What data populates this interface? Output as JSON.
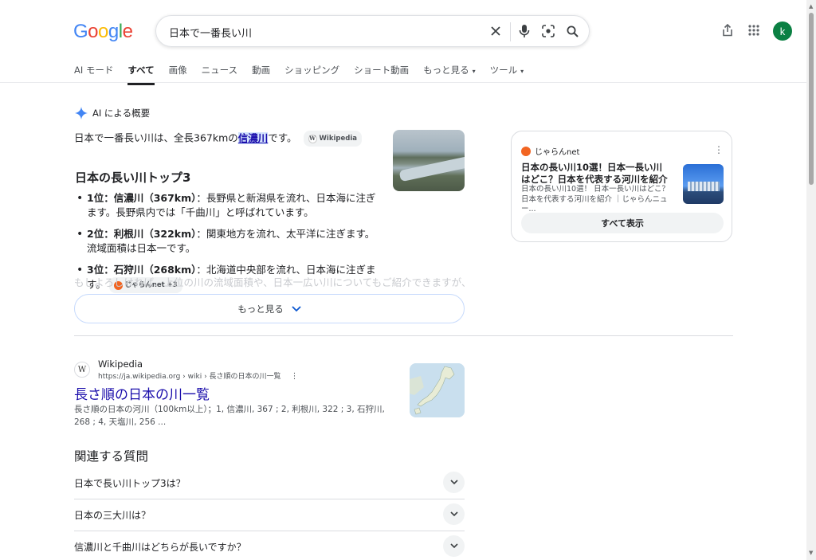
{
  "logo_letters": [
    "G",
    "o",
    "o",
    "g",
    "l",
    "e"
  ],
  "search": {
    "query": "日本で一番長い川"
  },
  "user": {
    "initial": "k"
  },
  "tabs": [
    {
      "label": "AI モード",
      "caret": ""
    },
    {
      "label": "すべて",
      "caret": ""
    },
    {
      "label": "画像",
      "caret": ""
    },
    {
      "label": "ニュース",
      "caret": ""
    },
    {
      "label": "動画",
      "caret": ""
    },
    {
      "label": "ショッピング",
      "caret": ""
    },
    {
      "label": "ショート動画",
      "caret": ""
    },
    {
      "label": "もっと見る",
      "caret": "▾"
    },
    {
      "label": "ツール",
      "caret": "▾"
    }
  ],
  "ai": {
    "heading": "AI による概要",
    "intro_pre": "日本で一番長い川は、全長367kmの",
    "intro_link": "信濃川",
    "intro_post": "です。",
    "intro_chip": "Wikipedia",
    "section_title": "日本の長い川トップ3",
    "items": [
      {
        "bold": "1位：信濃川（367km）",
        "text": "：長野県と新潟県を流れ、日本海に注ぎます。長野県内では「千曲川」と呼ばれています。"
      },
      {
        "bold": "2位：利根川（322km）",
        "text": "：関東地方を流れ、太平洋に注ぎます。流域面積は日本一です。"
      },
      {
        "bold": "3位：石狩川（268km）",
        "text": "：北海道中央部を流れ、日本海に注ぎます。"
      }
    ],
    "item3_chip": "じゃらんnet +3",
    "faded_text": "もしよろしければ、上位の川の流域面積や、日本一広い川についてもご紹介できますが、",
    "more_label": "もっと見る"
  },
  "side_card": {
    "source": "じゃらんnet",
    "title": "日本の長い川10選！日本一長い川はどこ？日本を代表する河川を紹介",
    "snippet": "日本の長い川10選！ 日本一長い川はどこ？ 日本を代表する河川を紹介 ｜じゃらんニュー...",
    "all_label": "すべて表示"
  },
  "result": {
    "favicon": "W",
    "site": "Wikipedia",
    "url": "https://ja.wikipedia.org › wiki › 長さ順の日本の川一覧",
    "title": "長さ順の日本の川一覧",
    "snippet": "長さ順の日本の河川（100km以上）；1, 信濃川, 367 ; 2, 利根川, 322 ; 3, 石狩川, 268 ; 4, 天塩川, 256 ..."
  },
  "paa": {
    "heading": "関連する質問",
    "questions": [
      "日本で長い川トップ3は？",
      "日本の三大川は？",
      "信濃川と千曲川はどちらが長いですか？"
    ]
  }
}
